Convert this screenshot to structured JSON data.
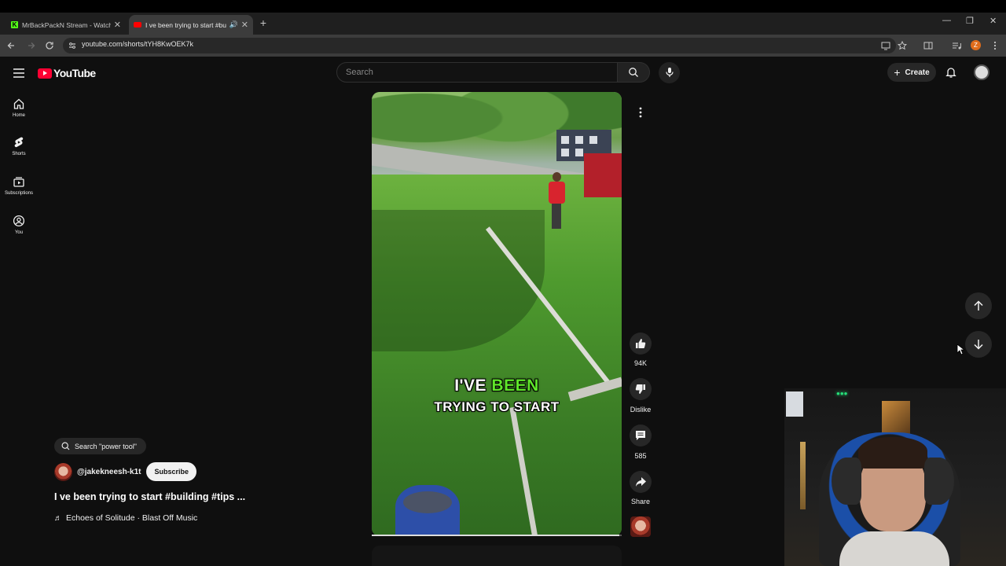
{
  "browser": {
    "tabs": [
      {
        "title": "MrBackPackN Stream - Watch l",
        "active": false
      },
      {
        "title": "I ve been trying to start #bu",
        "active": true
      }
    ],
    "url": "youtube.com/shorts/tYH8KwOEK7k",
    "profile_initial": "Z"
  },
  "header": {
    "logo_text": "YouTube",
    "search_placeholder": "Search",
    "create_label": "Create"
  },
  "sidebar": {
    "items": [
      {
        "label": "Home",
        "icon": "home-icon"
      },
      {
        "label": "Shorts",
        "icon": "shorts-icon"
      },
      {
        "label": "Subscriptions",
        "icon": "subscriptions-icon"
      },
      {
        "label": "You",
        "icon": "you-icon"
      }
    ]
  },
  "video": {
    "caption_word1": "I'VE",
    "caption_word2": "BEEN",
    "caption_line2": "TRYING TO START",
    "caption_highlight_color": "#5fe62a",
    "progress": 0.99
  },
  "actions": {
    "likes": "94K",
    "dislike_label": "Dislike",
    "comments": "585",
    "share_label": "Share"
  },
  "info": {
    "search_chip": "Search \"power tool\"",
    "channel": "@jakekneesh-k1t",
    "subscribe_label": "Subscribe",
    "title": "I ve been trying to start #building #tips ...",
    "music": "Echoes of Solitude · Blast Off Music"
  },
  "colors": {
    "background": "#0f0f0f",
    "brand_red": "#ff0033",
    "chip_bg": "#272727"
  }
}
